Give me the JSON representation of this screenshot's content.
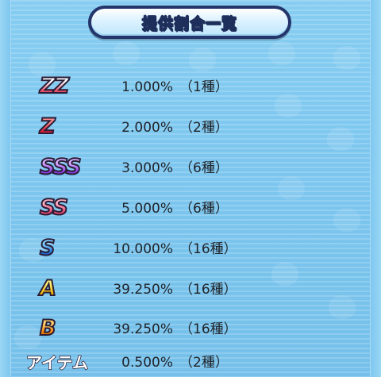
{
  "header": {
    "title": "提供割合一覧"
  },
  "rows": [
    {
      "rank": "ZZ",
      "rate": "1.000%",
      "count": "（1種）",
      "color_top": "#ffffff",
      "color_bottom": "#e94f6a"
    },
    {
      "rank": "Z",
      "rate": "2.000%",
      "count": "（2種）",
      "color_top": "#ff8a8a",
      "color_bottom": "#d61f3a"
    },
    {
      "rank": "SSS",
      "rate": "3.000%",
      "count": "（6種）",
      "color_top": "#d9b0ff",
      "color_bottom": "#8a3ee0"
    },
    {
      "rank": "SS",
      "rate": "5.000%",
      "count": "（6種）",
      "color_top": "#ffb0c4",
      "color_bottom": "#e8456f"
    },
    {
      "rank": "S",
      "rate": "10.000%",
      "count": "（16種）",
      "color_top": "#7fd3ff",
      "color_bottom": "#1f69d6"
    },
    {
      "rank": "A",
      "rate": "39.250%",
      "count": "（16種）",
      "color_top": "#fff27a",
      "color_bottom": "#f0b400"
    },
    {
      "rank": "B",
      "rate": "39.250%",
      "count": "（16種）",
      "color_top": "#ffcf6a",
      "color_bottom": "#f07a00"
    },
    {
      "rank": "アイテム",
      "rate": "0.500%",
      "count": "（2種）",
      "color_top": "#ffffff",
      "color_bottom": "#ffffff"
    }
  ]
}
